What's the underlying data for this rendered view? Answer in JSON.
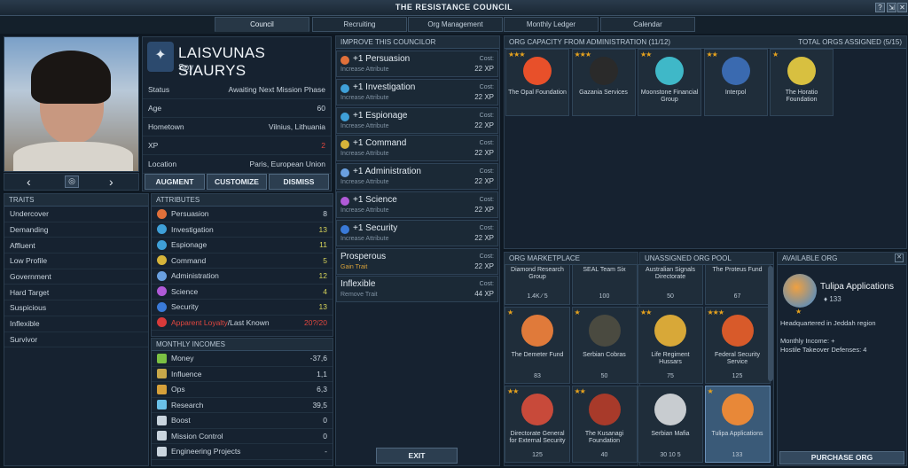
{
  "window": {
    "title": "THE RESISTANCE COUNCIL",
    "help": "?",
    "restore": "⇲",
    "close": "✕"
  },
  "tabs": [
    "Council",
    "Recruiting",
    "Org Management",
    "Monthly Ledger",
    "Calendar"
  ],
  "agent": {
    "name": "LAISVUNAS SIAURYS",
    "role": "Spy",
    "fields": [
      {
        "k": "Status",
        "v": "Awaiting Next Mission Phase"
      },
      {
        "k": "Age",
        "v": "60"
      },
      {
        "k": "Hometown",
        "v": "Vilnius, Lithuania"
      },
      {
        "k": "XP",
        "v": "2"
      },
      {
        "k": "Location",
        "v": "Paris, European Union"
      }
    ],
    "buttons": {
      "augment": "AUGMENT",
      "customize": "CUSTOMIZE",
      "dismiss": "DISMISS"
    }
  },
  "traits": {
    "header": "TRAITS",
    "items": [
      "Undercover",
      "Demanding",
      "Affluent",
      "Low Profile",
      "Government",
      "Hard Target",
      "Suspicious",
      "Inflexible",
      "Survivor"
    ]
  },
  "attributes": {
    "header": "ATTRIBUTES",
    "items": [
      {
        "k": "Persuasion",
        "v": "8",
        "color": "#e0703a"
      },
      {
        "k": "Investigation",
        "v": "13",
        "color": "#3fa0d8"
      },
      {
        "k": "Espionage",
        "v": "11",
        "color": "#3fa0d8"
      },
      {
        "k": "Command",
        "v": "5",
        "color": "#d6b43a"
      },
      {
        "k": "Administration",
        "v": "12",
        "color": "#6aa0e0"
      },
      {
        "k": "Science",
        "v": "4",
        "color": "#b05ad8"
      },
      {
        "k": "Security",
        "v": "13",
        "color": "#3a7ad8"
      },
      {
        "k": "Apparent Loyalty",
        "k2": "/Last Known",
        "v": "20?/20",
        "color": "#d83a3a"
      }
    ]
  },
  "incomes": {
    "header": "MONTHLY INCOMES",
    "items": [
      {
        "k": "Money",
        "v": "-37,6",
        "color": "#7bc043"
      },
      {
        "k": "Influence",
        "v": "1,1",
        "color": "#c8a84a"
      },
      {
        "k": "Ops",
        "v": "6,3",
        "color": "#d6a03a"
      },
      {
        "k": "Research",
        "v": "39,5",
        "color": "#6ac0e8"
      },
      {
        "k": "Boost",
        "v": "0",
        "color": "#c9d4de"
      },
      {
        "k": "Mission Control",
        "v": "0",
        "color": "#c9d4de"
      },
      {
        "k": "Engineering Projects",
        "v": "-",
        "color": "#c9d4de"
      }
    ]
  },
  "improve": {
    "header": "IMPROVE THIS COUNCILOR",
    "items": [
      {
        "n": "+1 Persuasion",
        "s": "Increase Attribute",
        "c": "Cost:",
        "x": "22 XP",
        "color": "#e0703a"
      },
      {
        "n": "+1 Investigation",
        "s": "Increase Attribute",
        "c": "Cost:",
        "x": "22 XP",
        "color": "#3fa0d8"
      },
      {
        "n": "+1 Espionage",
        "s": "Increase Attribute",
        "c": "Cost:",
        "x": "22 XP",
        "color": "#3fa0d8"
      },
      {
        "n": "+1 Command",
        "s": "Increase Attribute",
        "c": "Cost:",
        "x": "22 XP",
        "color": "#d6b43a"
      },
      {
        "n": "+1 Administration",
        "s": "Increase Attribute",
        "c": "Cost:",
        "x": "22 XP",
        "color": "#6aa0e0"
      },
      {
        "n": "+1 Science",
        "s": "Increase Attribute",
        "c": "Cost:",
        "x": "22 XP",
        "color": "#b05ad8"
      },
      {
        "n": "+1 Security",
        "s": "Increase Attribute",
        "c": "Cost:",
        "x": "22 XP",
        "color": "#3a7ad8"
      },
      {
        "n": "Prosperous",
        "s": "Gain Trait",
        "c": "Cost:",
        "x": "22 XP",
        "color": ""
      },
      {
        "n": "Inflexible",
        "s": "Remove Trait",
        "c": "Cost:",
        "x": "44 XP",
        "color": ""
      }
    ],
    "exit": "EXIT"
  },
  "capacity": {
    "header": "ORG CAPACITY FROM ADMINISTRATION (11/12)",
    "total": "TOTAL ORGS ASSIGNED (5/15)",
    "orgs": [
      {
        "name": "The Opal Foundation",
        "stars": "★★★",
        "color": "#e8502a"
      },
      {
        "name": "Gazania Services",
        "stars": "★★★",
        "color": "#2a2a2a"
      },
      {
        "name": "Moonstone Financial Group",
        "stars": "★★",
        "color": "#3fb8c8"
      },
      {
        "name": "Interpol",
        "stars": "★★",
        "color": "#3a6ab0"
      },
      {
        "name": "The Horatio Foundation",
        "stars": "★",
        "color": "#d8c040"
      }
    ]
  },
  "market": {
    "header": "ORG MARKETPLACE",
    "items": [
      {
        "name": "Diamond Research Group",
        "stars": "",
        "sub": "1.4K ⁄ 5",
        "color": "#3a5a6e"
      },
      {
        "name": "SEAL Team Six",
        "stars": "",
        "sub": "100",
        "color": "#3a4a5e"
      },
      {
        "name": "The Demeter Fund",
        "stars": "★",
        "sub": "83",
        "color": "#e07a3a"
      },
      {
        "name": "Serbian Cobras",
        "stars": "★",
        "sub": "50",
        "color": "#4a4a40"
      },
      {
        "name": "Directorate General for External Security",
        "stars": "★★",
        "sub": "125",
        "color": "#c84a3a"
      },
      {
        "name": "The Kusanagi Foundation",
        "stars": "★★",
        "sub": "40",
        "color": "#a83a2a"
      }
    ]
  },
  "pool": {
    "header": "UNASSIGNED ORG POOL",
    "items": [
      {
        "name": "Australian Signals Directorate",
        "stars": "",
        "sub": "50",
        "color": "#3a4a5e"
      },
      {
        "name": "The Proteus Fund",
        "stars": "",
        "sub": "67",
        "color": "#3a4a5e"
      },
      {
        "name": "Life Regiment Hussars",
        "stars": "★★",
        "sub": "75",
        "color": "#d8a838"
      },
      {
        "name": "Federal Security Service",
        "stars": "★★★",
        "sub": "125",
        "color": "#d85a2a"
      },
      {
        "name": "Serbian Mafia",
        "stars": "",
        "sub": "30  10  5",
        "color": "#c8ccd0"
      },
      {
        "name": "Tulipa Applications",
        "stars": "★",
        "sub": "133",
        "color": "#e88838"
      }
    ]
  },
  "available": {
    "header": "AVAILABLE ORG",
    "name": "Tulipa Applications",
    "value": "133",
    "hq": "Headquartered in Jeddah region",
    "income": "Monthly Income: +",
    "hostile": "Hostile Takeover Defenses: 4",
    "purchase": "PURCHASE ORG",
    "star": "★"
  }
}
